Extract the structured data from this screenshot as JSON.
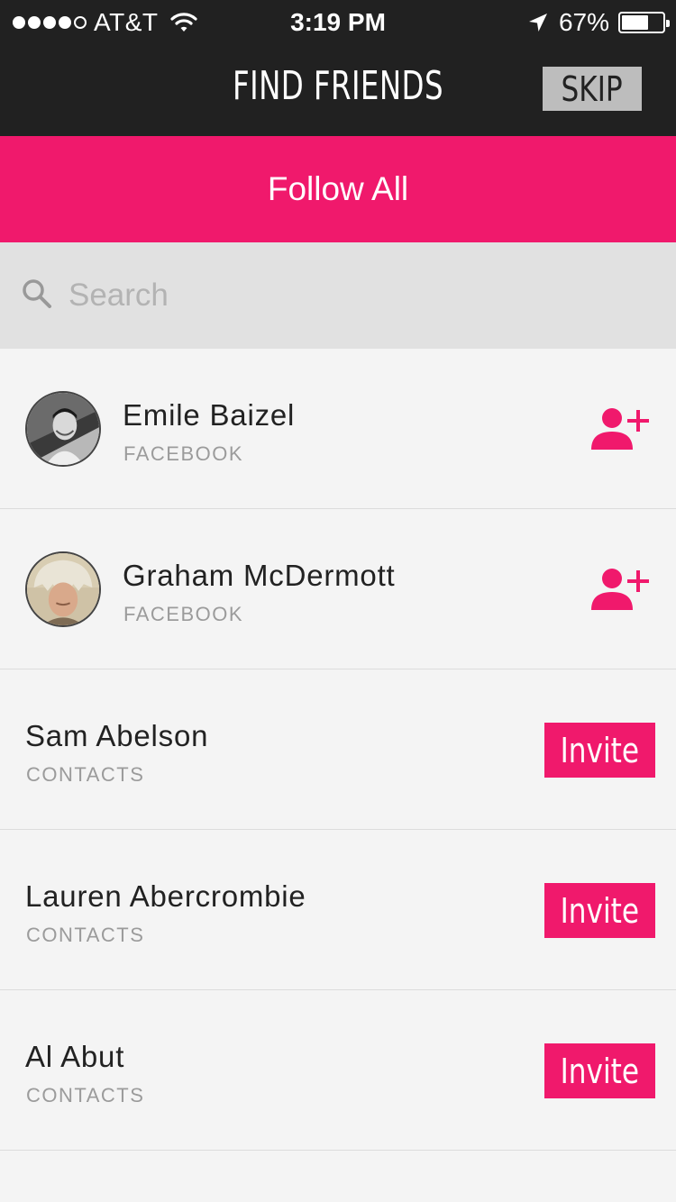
{
  "status_bar": {
    "carrier": "AT&T",
    "time": "3:19 PM",
    "battery_percent": "67%",
    "battery_level": 0.67,
    "signal_bars_filled": 4,
    "signal_bars_total": 5
  },
  "nav": {
    "title": "FIND FRIENDS",
    "skip_label": "SKIP"
  },
  "follow_all_label": "Follow All",
  "search": {
    "placeholder": "Search",
    "value": ""
  },
  "colors": {
    "accent": "#f0196c",
    "header_bg": "#212121",
    "search_bg": "#e1e1e1",
    "list_bg": "#f4f4f4"
  },
  "friends": [
    {
      "name": "Emile Baizel",
      "source": "FACEBOOK",
      "action": "add-friend-icon"
    },
    {
      "name": "Graham McDermott",
      "source": "FACEBOOK",
      "action": "add-friend-icon"
    },
    {
      "name": "Sam Abelson",
      "source": "CONTACTS",
      "action_label": "Invite"
    },
    {
      "name": "Lauren Abercrombie",
      "source": "CONTACTS",
      "action_label": "Invite"
    },
    {
      "name": "Al Abut",
      "source": "CONTACTS",
      "action_label": "Invite"
    }
  ]
}
